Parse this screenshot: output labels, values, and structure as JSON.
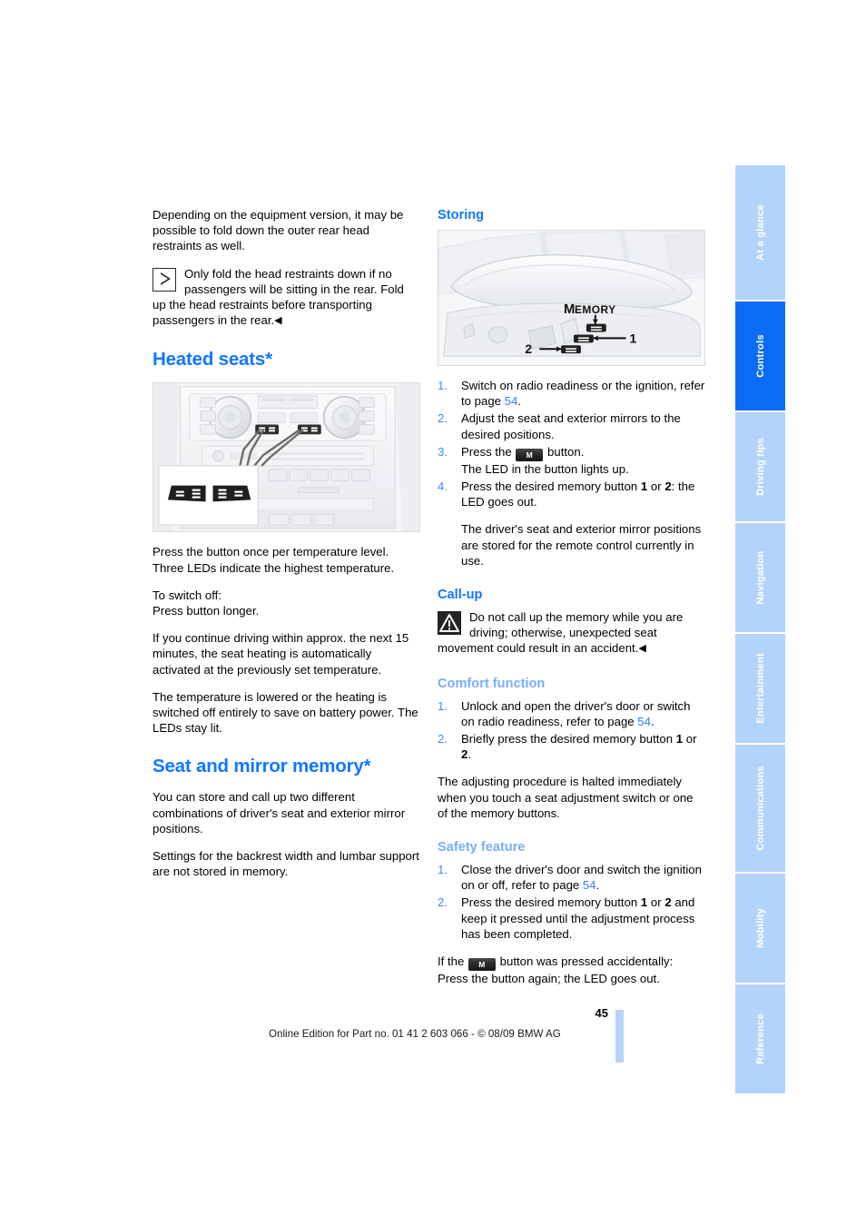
{
  "document": {
    "page_number": "45",
    "footer_text": "Online Edition for Part no. 01 41 2 603 066 - © 08/09 BMW AG"
  },
  "tabs": [
    {
      "label": "At a glance",
      "active": false
    },
    {
      "label": "Controls",
      "active": true
    },
    {
      "label": "Driving tips",
      "active": false
    },
    {
      "label": "Navigation",
      "active": false
    },
    {
      "label": "Entertainment",
      "active": false
    },
    {
      "label": "Communications",
      "active": false
    },
    {
      "label": "Mobility",
      "active": false
    },
    {
      "label": "Reference",
      "active": false
    }
  ],
  "left_column": {
    "intro_paragraph": "Depending on the equipment version, it may be possible to fold down the outer rear head restraints as well.",
    "note": {
      "icon": "triangle-outline-icon",
      "text": "Only fold the head restraints down if no passengers will be sitting in the rear. Fold up the head restraints before transporting passengers in the rear.",
      "end_mark": "◀"
    },
    "heated_seats": {
      "title": "Heated seats*",
      "figure_name": "heated-seats-console-figure",
      "paragraphs": [
        "Press the button once per temperature level. Three LEDs indicate the highest temperature.",
        "To switch off:\nPress button longer.",
        "If you continue driving within approx. the next 15 minutes, the seat heating is automatically activated at the previously set temperature.",
        "The temperature is lowered or the heating is switched off entirely to save on battery power. The LEDs stay lit."
      ]
    },
    "seat_mirror_memory": {
      "title": "Seat and mirror memory*",
      "paragraphs": [
        "You can store and call up two different combinations of driver's seat and exterior mirror positions.",
        "Settings for the backrest width and lumbar support are not stored in memory."
      ]
    }
  },
  "right_column": {
    "storing": {
      "title": "Storing",
      "figure_name": "seat-memory-buttons-figure",
      "figure_labels": {
        "memory": "MEMORY",
        "button_one": "1",
        "button_two": "2"
      },
      "steps": [
        {
          "text_before": "Switch on radio readiness or the ignition, refer to page ",
          "page_link": "54",
          "text_after": "."
        },
        {
          "text_before": "Adjust the seat and exterior mirrors to the desired positions.",
          "page_link": "",
          "text_after": ""
        },
        {
          "text_before": "Press the ",
          "m_button": "M",
          "text_after": " button.\nThe LED in the button lights up."
        },
        {
          "text_before": "Press the desired memory button ",
          "bold_one": "1",
          "text_mid": " or ",
          "bold_two": "2",
          "text_after": ": the LED goes out.",
          "extra": "The driver's seat and exterior mirror positions are stored for the remote control currently in use."
        }
      ]
    },
    "call_up": {
      "title": "Call-up",
      "warning": {
        "icon": "warning-triangle-icon",
        "text": "Do not call up the memory while you are driving; otherwise, unexpected seat movement could result in an accident.",
        "end_mark": "◀"
      }
    },
    "comfort_function": {
      "title": "Comfort function",
      "steps": [
        {
          "text_before": "Unlock and open the driver's door or switch on radio readiness, refer to page ",
          "page_link": "54",
          "text_after": "."
        },
        {
          "text_before": "Briefly press the desired memory button ",
          "bold_one": "1",
          "text_mid": " or ",
          "bold_two": "2",
          "text_after": "."
        }
      ],
      "closing_paragraph": "The adjusting procedure is halted immediately when you touch a seat adjustment switch or one of the memory buttons."
    },
    "safety_feature": {
      "title": "Safety feature",
      "steps": [
        {
          "text_before": "Close the driver's door and switch the ignition on or off, refer to page ",
          "page_link": "54",
          "text_after": "."
        },
        {
          "text_before": "Press the desired memory button ",
          "bold_one": "1",
          "text_mid": " or ",
          "bold_two": "2",
          "text_after": " and keep it pressed until the adjustment process has been completed."
        }
      ],
      "closing": {
        "text_before": "If the ",
        "m_button": "M",
        "text_after": " button was pressed accidentally:\nPress the button again; the LED goes out."
      }
    }
  },
  "colors": {
    "heading_blue": "#1177ff",
    "subheading_blue": "#1177ff",
    "subheading_pale_blue": "#78aefb",
    "tab_inactive": "#b3d3fb",
    "tab_active": "#0a6cf5",
    "link_blue": "#2f7ff0"
  }
}
